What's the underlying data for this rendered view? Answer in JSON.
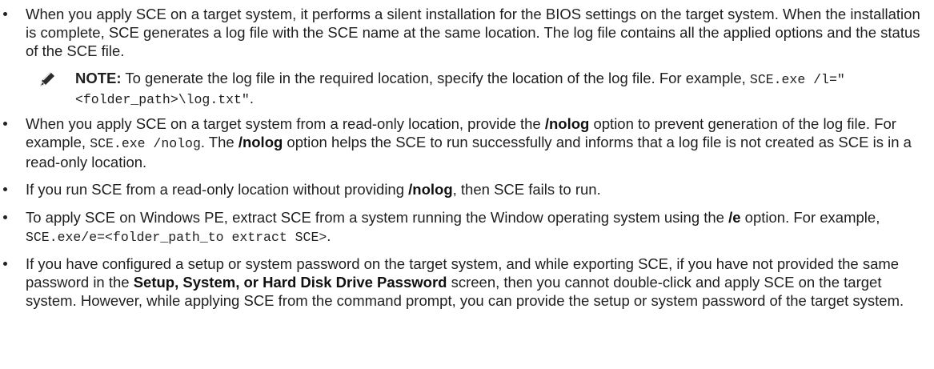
{
  "bullets": {
    "b1": {
      "text": "When you apply SCE on a target system, it performs a silent installation for the BIOS settings on the target system. When the installation is complete, SCE generates a log file with the SCE name at the same location. The log file contains all the applied options and the status of the SCE file."
    },
    "note": {
      "label": "NOTE:",
      "text": " To generate the log file in the required location, specify the location of the log file. For example, ",
      "code": "SCE.exe /l=\"<folder_path>\\log.txt\"",
      "end": ".",
      "icon": "pencil-note-icon"
    },
    "b2": {
      "t1": "When you apply SCE on a target system from a read-only location, provide the ",
      "k1": "/nolog",
      "t2": " option to prevent generation of the log file. For example, ",
      "code": "SCE.exe /nolog",
      "t3": ". The ",
      "k2": "/nolog",
      "t4": " option helps the SCE to run successfully and informs that a log file is not created as SCE is in a read-only location."
    },
    "b3": {
      "t1": "If you run SCE from a read-only location without providing ",
      "k1": "/nolog",
      "t2": ", then SCE fails to run."
    },
    "b4": {
      "t1": "To apply SCE on Windows PE, extract SCE from a system running the Window operating system using the ",
      "k1": "/e",
      "t2": " option. For example, ",
      "code": "SCE.exe/e=<folder_path_to extract SCE>",
      "t3": "."
    },
    "b5": {
      "t1": "If you have configured a setup or system password on the target system, and while exporting SCE, if you have not provided the same password in the ",
      "k1": "Setup, System, or Hard Disk Drive Password",
      "t2": " screen, then you cannot double-click and apply SCE on the target system. However, while applying SCE from the command prompt, you can provide the setup or system password of the target system."
    }
  }
}
